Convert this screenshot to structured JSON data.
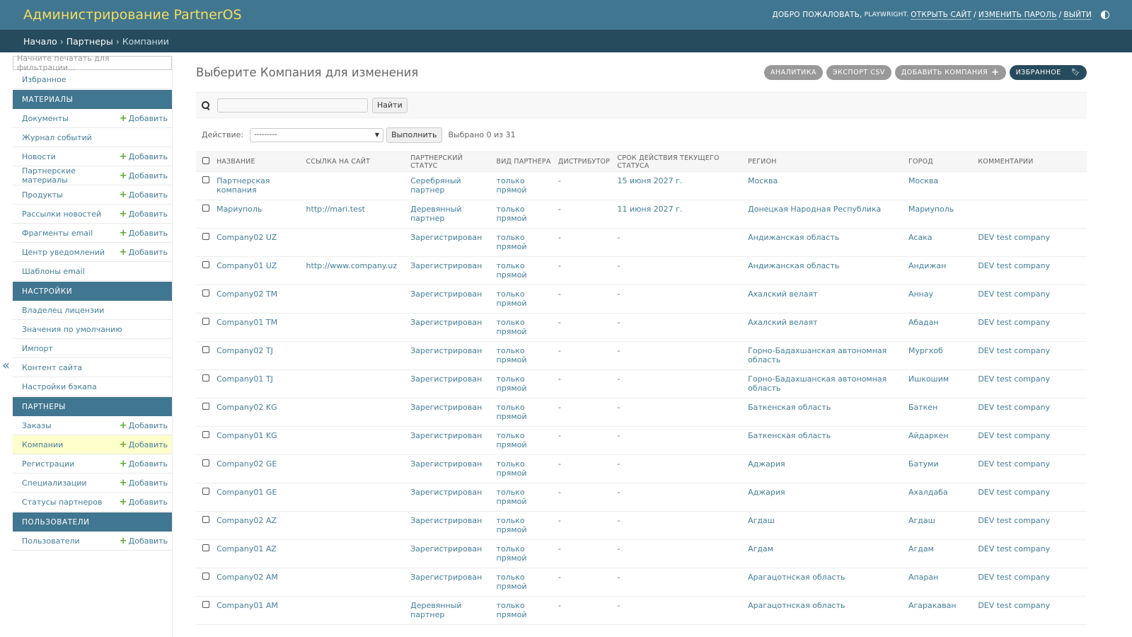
{
  "header": {
    "title": "Администрирование PartnerOS",
    "welcome": "ДОБРО ПОЖАЛОВАТЬ,",
    "username": "PLAYWRIGHT.",
    "view_site": "ОТКРЫТЬ САЙТ",
    "change_password": "ИЗМЕНИТЬ ПАРОЛЬ",
    "logout": "ВЫЙТИ"
  },
  "breadcrumbs": {
    "home": "Начало",
    "app": "Партнеры",
    "current": "Компании"
  },
  "sidebar": {
    "filter_placeholder": "Начните печатать для фильтрации...",
    "favorites": "Избранное",
    "add_label": "Добавить",
    "sections": [
      {
        "title": "МАТЕРИАЛЫ",
        "items": [
          {
            "label": "Документы",
            "add": true
          },
          {
            "label": "Журнал событий",
            "add": false
          },
          {
            "label": "Новости",
            "add": true
          },
          {
            "label": "Партнерские материалы",
            "add": true
          },
          {
            "label": "Продукты",
            "add": true
          },
          {
            "label": "Рассылки новостей",
            "add": true
          },
          {
            "label": "Фрагменты email",
            "add": true
          },
          {
            "label": "Центр уведомлений",
            "add": true
          },
          {
            "label": "Шаблоны email",
            "add": false
          }
        ]
      },
      {
        "title": "НАСТРОЙКИ",
        "items": [
          {
            "label": "Владелец лицензии",
            "add": false
          },
          {
            "label": "Значения по умолчанию",
            "add": false
          },
          {
            "label": "Импорт",
            "add": false
          },
          {
            "label": "Контент сайта",
            "add": false
          },
          {
            "label": "Настройки бэкапа",
            "add": false
          }
        ]
      },
      {
        "title": "ПАРТНЕРЫ",
        "items": [
          {
            "label": "Заказы",
            "add": true
          },
          {
            "label": "Компании",
            "add": true,
            "active": true
          },
          {
            "label": "Регистрации",
            "add": true
          },
          {
            "label": "Специализации",
            "add": true
          },
          {
            "label": "Статусы партнеров",
            "add": true
          }
        ]
      },
      {
        "title": "ПОЛЬЗОВАТЕЛИ",
        "items": [
          {
            "label": "Пользователи",
            "add": true
          }
        ]
      }
    ]
  },
  "content": {
    "title": "Выберите Компания для изменения",
    "tools": [
      "АНАЛИТИКА",
      "ЭКСПОРТ CSV",
      "ДОБАВИТЬ КОМПАНИЯ"
    ],
    "favorite_button": "ИЗБРАННОЕ",
    "search_button": "Найти",
    "action_label": "Действие:",
    "action_selected": "---------",
    "action_go": "Выполнить",
    "selected_counter": "Выбрано 0 из 31",
    "columns": [
      "НАЗВАНИЕ",
      "ССЫЛКА НА САЙТ",
      "ПАРТНЕРСКИЙ СТАТУС",
      "ВИД ПАРТНЕРА",
      "ДИСТРИБУТОР",
      "СРОК ДЕЙСТВИЯ ТЕКУЩЕГО СТАТУСА",
      "РЕГИОН",
      "ГОРОД",
      "КОММЕНТАРИИ"
    ],
    "rows": [
      [
        "Партнерская компания",
        "",
        "Серебряный партнер",
        "только прямой",
        "-",
        "15 июня 2027 г.",
        "Москва",
        "Москва",
        ""
      ],
      [
        "Мариуполь",
        "http://mari.test",
        "Деревянный партнер",
        "только прямой",
        "-",
        "11 июня 2027 г.",
        "Донецкая Народная Республика",
        "Мариуполь",
        ""
      ],
      [
        "Company02 UZ",
        "",
        "Зарегистрирован",
        "только прямой",
        "-",
        "-",
        "Андижанская область",
        "Асака",
        "DEV test company"
      ],
      [
        "Company01 UZ",
        "http://www.company.uz",
        "Зарегистрирован",
        "только прямой",
        "-",
        "-",
        "Андижанская область",
        "Андижан",
        "DEV test company"
      ],
      [
        "Company02 TM",
        "",
        "Зарегистрирован",
        "только прямой",
        "-",
        "-",
        "Ахалский велаят",
        "Аннау",
        "DEV test company"
      ],
      [
        "Company01 TM",
        "",
        "Зарегистрирован",
        "только прямой",
        "-",
        "-",
        "Ахалский велаят",
        "Абадан",
        "DEV test company"
      ],
      [
        "Company02 TJ",
        "",
        "Зарегистрирован",
        "только прямой",
        "-",
        "-",
        "Горно-Бадахшанская автономная область",
        "Мургхоб",
        "DEV test company"
      ],
      [
        "Company01 TJ",
        "",
        "Зарегистрирован",
        "только прямой",
        "-",
        "-",
        "Горно-Бадахшанская автономная область",
        "Ишкошим",
        "DEV test company"
      ],
      [
        "Company02 KG",
        "",
        "Зарегистрирован",
        "только прямой",
        "-",
        "-",
        "Баткенская область",
        "Баткен",
        "DEV test company"
      ],
      [
        "Company01 KG",
        "",
        "Зарегистрирован",
        "только прямой",
        "-",
        "-",
        "Баткенская область",
        "Айдаркен",
        "DEV test company"
      ],
      [
        "Company02 GE",
        "",
        "Зарегистрирован",
        "только прямой",
        "-",
        "-",
        "Аджария",
        "Батуми",
        "DEV test company"
      ],
      [
        "Company01 GE",
        "",
        "Зарегистрирован",
        "только прямой",
        "-",
        "-",
        "Аджария",
        "Ахалдаба",
        "DEV test company"
      ],
      [
        "Company02 AZ",
        "",
        "Зарегистрирован",
        "только прямой",
        "-",
        "-",
        "Агдаш",
        "Агдаш",
        "DEV test company"
      ],
      [
        "Company01 AZ",
        "",
        "Зарегистрирован",
        "только прямой",
        "-",
        "-",
        "Агдам",
        "Агдам",
        "DEV test company"
      ],
      [
        "Company02 AM",
        "",
        "Зарегистрирован",
        "только прямой",
        "-",
        "-",
        "Арагацотнская область",
        "Апаран",
        "DEV test company"
      ],
      [
        "Company01 AM",
        "",
        "Деревянный партнер",
        "только прямой",
        "-",
        "-",
        "Арагацотнская область",
        "Агаракаван",
        "DEV test company"
      ]
    ]
  }
}
